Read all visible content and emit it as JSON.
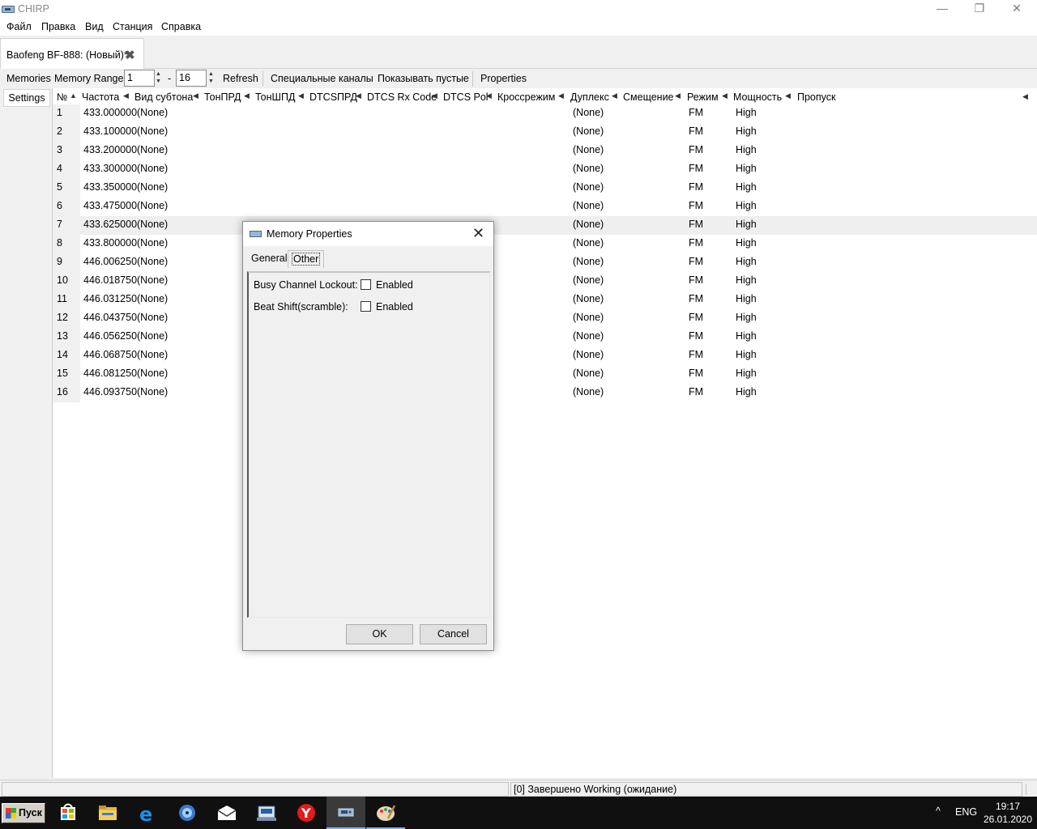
{
  "window": {
    "title": "CHIRP",
    "minimize_glyph": "—",
    "maximize_glyph": "❐",
    "close_glyph": "✕"
  },
  "menu": [
    "Файл",
    "Правка",
    "Вид",
    "Станция",
    "Справка"
  ],
  "tab": {
    "label": "Baofeng BF-888: (Новый)*",
    "close_glyph": "✖"
  },
  "toolbar": {
    "memories_label": "Memories",
    "memory_range_label": "Memory Range:",
    "range_start": "1",
    "range_dash": "-",
    "range_end": "16",
    "refresh_label": "Refresh",
    "special_channels_label": "Специальные каналы",
    "show_empty_label": "Показывать пустые",
    "properties_label": "Properties"
  },
  "left_pane": {
    "settings_label": "Settings"
  },
  "columns": [
    "№",
    "Частота",
    "Вид субтона",
    "ТонПРД",
    "ТонШПД",
    "DTCSПРД",
    "DTCS Rx Code",
    "DTCS Pol",
    "Кроссрежим",
    "Дуплекс",
    "Смещение",
    "Режим",
    "Мощность",
    "Пропуск"
  ],
  "sort_arrow_glyph": "▲",
  "column_arrow_glyph": "◀",
  "rows": [
    {
      "num": "1",
      "freq": "433.000000",
      "tone": "(None)",
      "duplex": "(None)",
      "mode": "FM",
      "power": "High"
    },
    {
      "num": "2",
      "freq": "433.100000",
      "tone": "(None)",
      "duplex": "(None)",
      "mode": "FM",
      "power": "High"
    },
    {
      "num": "3",
      "freq": "433.200000",
      "tone": "(None)",
      "duplex": "(None)",
      "mode": "FM",
      "power": "High"
    },
    {
      "num": "4",
      "freq": "433.300000",
      "tone": "(None)",
      "duplex": "(None)",
      "mode": "FM",
      "power": "High"
    },
    {
      "num": "5",
      "freq": "433.350000",
      "tone": "(None)",
      "duplex": "(None)",
      "mode": "FM",
      "power": "High"
    },
    {
      "num": "6",
      "freq": "433.475000",
      "tone": "(None)",
      "duplex": "(None)",
      "mode": "FM",
      "power": "High"
    },
    {
      "num": "7",
      "freq": "433.625000",
      "tone": "(None)",
      "duplex": "(None)",
      "mode": "FM",
      "power": "High"
    },
    {
      "num": "8",
      "freq": "433.800000",
      "tone": "(None)",
      "duplex": "(None)",
      "mode": "FM",
      "power": "High"
    },
    {
      "num": "9",
      "freq": "446.006250",
      "tone": "(None)",
      "duplex": "(None)",
      "mode": "FM",
      "power": "High"
    },
    {
      "num": "10",
      "freq": "446.018750",
      "tone": "(None)",
      "duplex": "(None)",
      "mode": "FM",
      "power": "High"
    },
    {
      "num": "11",
      "freq": "446.031250",
      "tone": "(None)",
      "duplex": "(None)",
      "mode": "FM",
      "power": "High"
    },
    {
      "num": "12",
      "freq": "446.043750",
      "tone": "(None)",
      "duplex": "(None)",
      "mode": "FM",
      "power": "High"
    },
    {
      "num": "13",
      "freq": "446.056250",
      "tone": "(None)",
      "duplex": "(None)",
      "mode": "FM",
      "power": "High"
    },
    {
      "num": "14",
      "freq": "446.068750",
      "tone": "(None)",
      "duplex": "(None)",
      "mode": "FM",
      "power": "High"
    },
    {
      "num": "15",
      "freq": "446.081250",
      "tone": "(None)",
      "duplex": "(None)",
      "mode": "FM",
      "power": "High"
    },
    {
      "num": "16",
      "freq": "446.093750",
      "tone": "(None)",
      "duplex": "(None)",
      "mode": "FM",
      "power": "High"
    }
  ],
  "selected_row": "7",
  "status": {
    "message": "[0] Завершено Working (ожидание)"
  },
  "dialog": {
    "title": "Memory Properties",
    "close_glyph": "✕",
    "tabs": [
      "General",
      "Other"
    ],
    "active_tab": "Other",
    "options": [
      {
        "label": "Busy Channel Lockout:",
        "checkbox_label": "Enabled",
        "checked": false
      },
      {
        "label": "Beat Shift(scramble):",
        "checkbox_label": "Enabled",
        "checked": false
      }
    ],
    "ok_label": "OK",
    "cancel_label": "Cancel"
  },
  "taskbar": {
    "start_label": "Пуск",
    "apps": [
      "store-icon",
      "folder-icon",
      "edge-icon",
      "media-icon",
      "mail-icon",
      "printer-icon",
      "yandex-icon",
      "chirp-icon",
      "paint-icon"
    ],
    "chevron_glyph": "^",
    "language": "ENG",
    "time": "19:17",
    "date": "26.01.2020"
  }
}
